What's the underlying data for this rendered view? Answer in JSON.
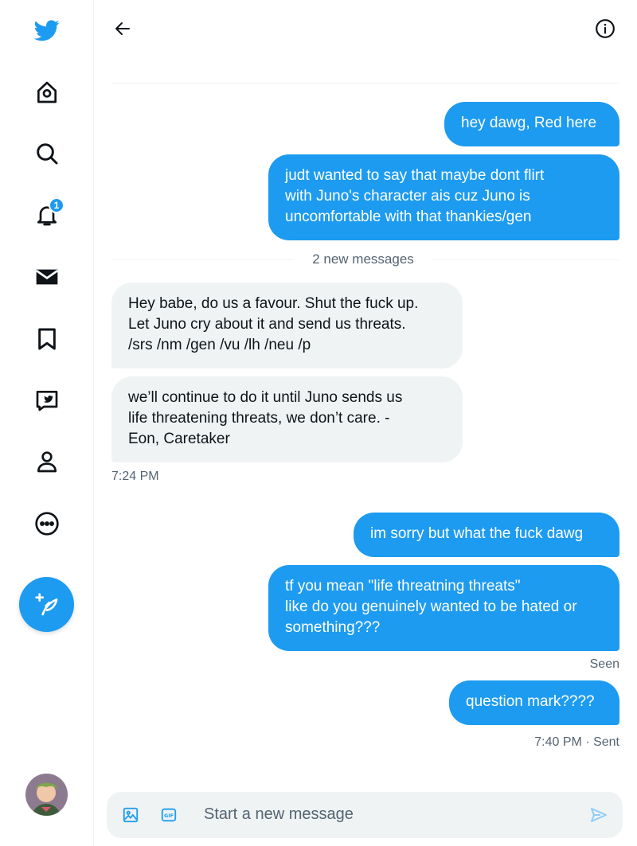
{
  "sidebar": {
    "notifications_badge": "1",
    "items": [
      "twitter-logo",
      "home",
      "explore",
      "notifications",
      "messages",
      "bookmarks",
      "twitter-blue",
      "profile",
      "more"
    ]
  },
  "colors": {
    "accent": "#1d9bf0",
    "incoming_bg": "#eff3f4",
    "muted_text": "#536471"
  },
  "composer": {
    "placeholder": "Start a new message"
  },
  "separator": {
    "label": "2 new messages"
  },
  "messages": [
    {
      "direction": "out",
      "text": "hey dawg, Red here"
    },
    {
      "direction": "out",
      "text": "judt wanted to say that maybe dont flirt\nwith Juno's character ais cuz Juno is\nuncomfortable with that thankies/gen"
    },
    {
      "direction": "in",
      "text": "Hey babe, do us a favour. Shut the fuck up.\nLet Juno cry about it and send us threats.\n/srs /nm /gen /vu /lh /neu /p"
    },
    {
      "direction": "in",
      "text": "we’ll continue to do it until Juno sends us\nlife threatening threats, we don’t care. -\nEon, Caretaker"
    },
    {
      "direction": "out",
      "text": "im sorry but what the fuck dawg"
    },
    {
      "direction": "out",
      "text": "tf you mean \"life threatning threats\"\nlike do you genuinely wanted to be hated or\nsomething???"
    },
    {
      "direction": "out",
      "text": "question mark????"
    }
  ],
  "timestamps": {
    "incoming_time": "7:24 PM",
    "seen": "Seen",
    "last_sent": "7:40 PM · Sent"
  }
}
